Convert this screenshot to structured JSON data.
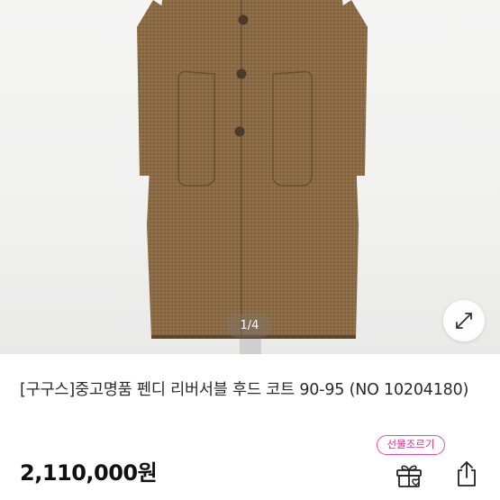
{
  "gallery": {
    "image_alt": "펜디 리버서블 후드 코트 상품 사진",
    "pager": "1/4",
    "expand_icon": "expand-arrows-icon"
  },
  "product": {
    "title": "[구구스]중고명품 펜디 리버서블 후드 코트 90-95 (NO 10204180)",
    "price": "2,110,000원"
  },
  "actions": {
    "gift_badge": "선물조르기",
    "gift_icon": "gift-icon",
    "share_icon": "share-icon"
  },
  "colors": {
    "gift_accent": "#e02f90",
    "coat": "#8a6a44"
  }
}
